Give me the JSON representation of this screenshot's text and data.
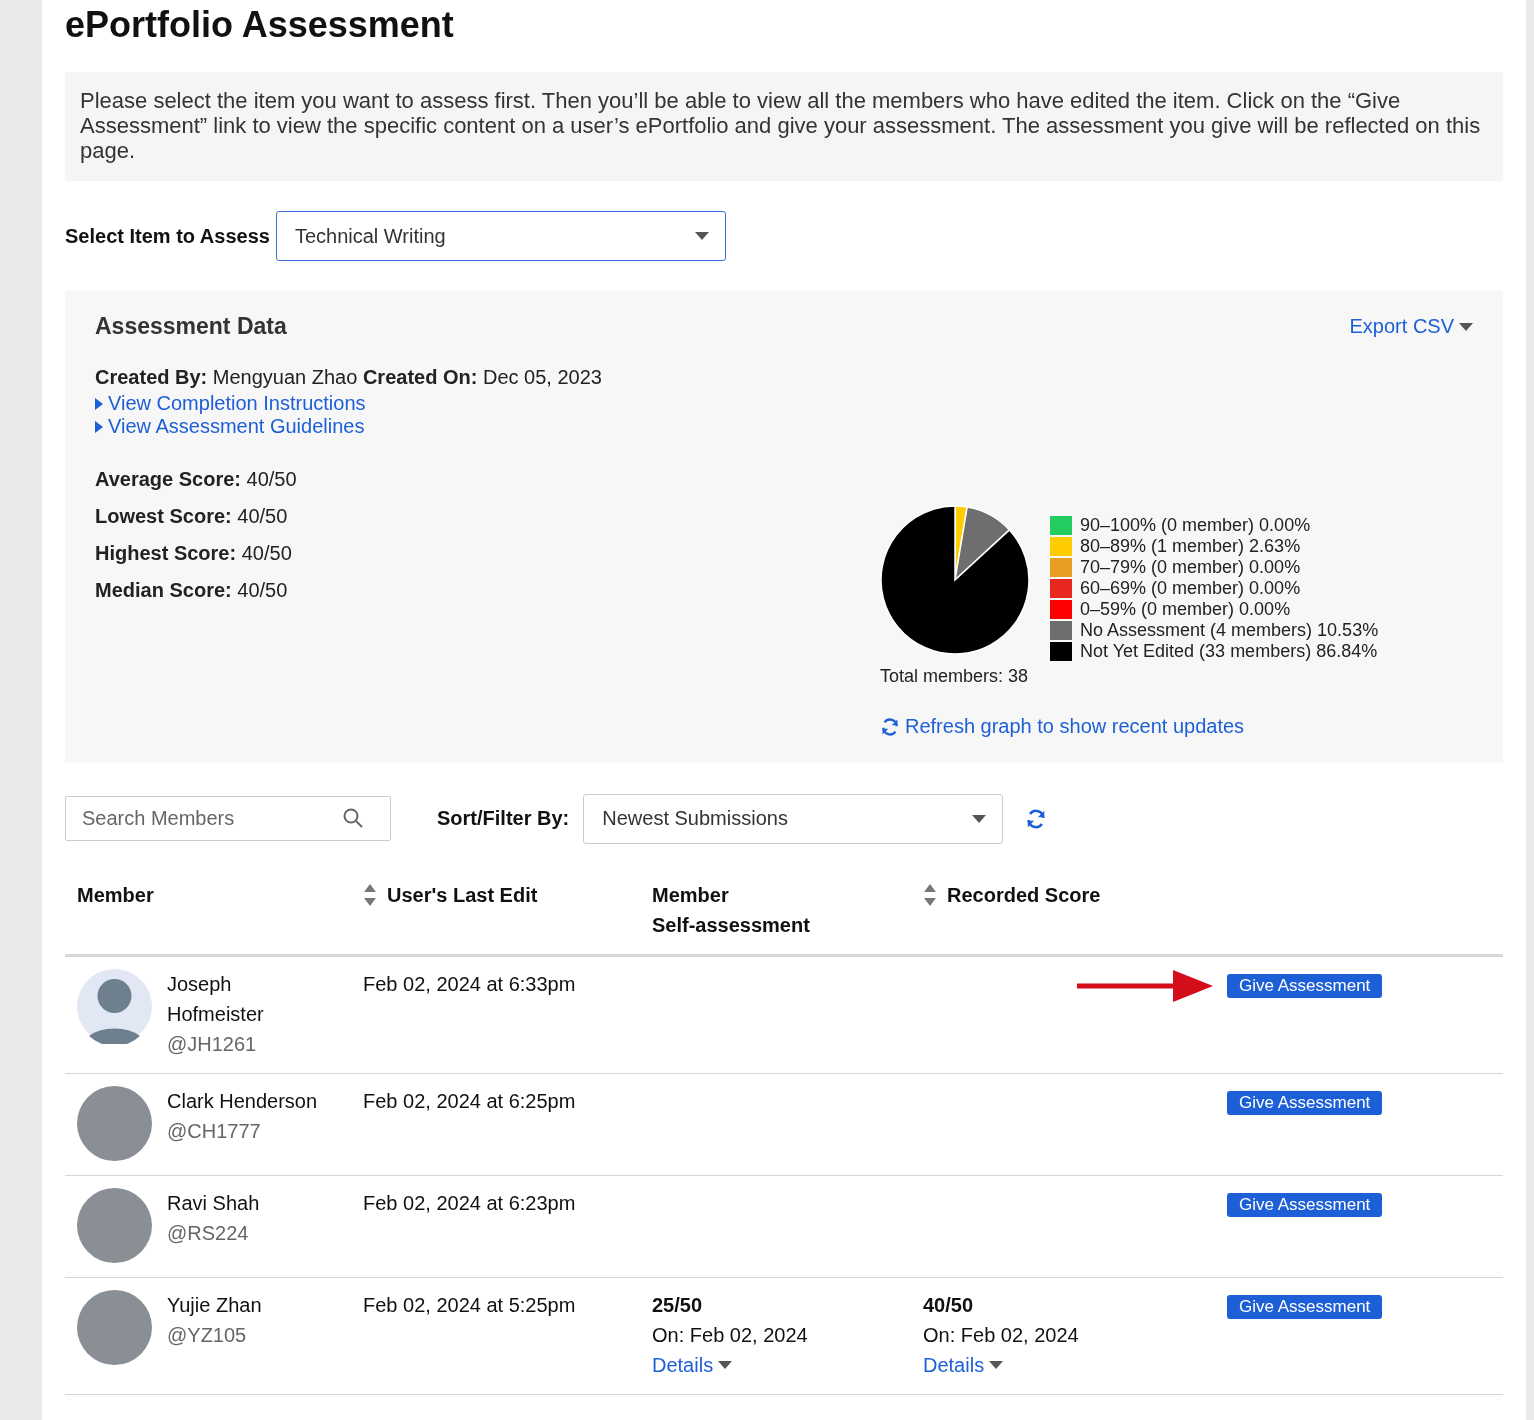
{
  "title": "ePortfolio Assessment",
  "intro": "Please select the item you want to assess first. Then you’ll be able to view all the members who have edited the item. Click on the “Give Assessment” link to view the specific content on a user’s ePortfolio and give your assessment. The assessment you give will be reflected on this page.",
  "item_select": {
    "label": "Select Item to Assess",
    "value": "Technical Writing"
  },
  "assessment_data": {
    "heading": "Assessment Data",
    "export_link": "Export CSV",
    "created": "**Created By:** Mengyuan Zhao **Created On:** Dec 05, 2023",
    "links": [
      "View Completion Instructions",
      "View Assessment Guidelines"
    ],
    "stats": [
      "**Average Score:** 40/50",
      "**Lowest Score:** 40/50",
      "**Highest Score:** 40/50",
      "**Median Score:** 40/50"
    ],
    "legend": [
      {
        "detail": "(0 member) 0.00%",
        "color": "#22cc5e"
      },
      {
        "detail": "(1 member) 2.63%",
        "color": "#ffcc00"
      },
      {
        "detail": "(0 member) 0.00%",
        "color": "#e89e22"
      },
      {
        "detail": "(0 member) 0.00%",
        "color": "#e8271f"
      },
      {
        "detail": "(0 member) 0.00%",
        "color": "#ff0000"
      },
      {
        "detail": "(4 members) 10.53%",
        "color": "#6e6e6e"
      },
      {
        "detail": "(33 members) 86.84%",
        "color": "#000000"
      }
    ],
    "chart_data": {
      "type": "pie",
      "categories": [
        "90–100%",
        "80–89%",
        "70–79%",
        "60–69%",
        "0–59%",
        "No Assessment",
        "Not Yet Edited"
      ],
      "series": [
        {
          "values": [
            0,
            2.63,
            0,
            0,
            0,
            10.53,
            86.84
          ]
        }
      ]
    },
    "total": "Total members: 38",
    "refresh_link": "Refresh graph to show recent updates"
  },
  "filters": {
    "search_placeholder": "Search Members",
    "sort_label": "Sort/Filter By:",
    "sort_value": "Newest Submissions"
  },
  "table": {
    "columns": [
      {
        "label": "Member",
        "sortable": false
      },
      {
        "label": "User's Last Edit",
        "sortable": true
      },
      {
        "label": "Member Self-assessment",
        "sortable": false
      },
      {
        "label": "Recorded Score",
        "sortable": true
      }
    ],
    "rows": [
      {
        "kind": "default",
        "name": "Joseph Hofmeister",
        "handle": "@JH1261",
        "last_edit": "Feb 02, 2024 at 6:33pm",
        "action": "Give Assessment",
        "arrow_marked": true
      },
      {
        "kind": "photo",
        "name": "Clark Henderson",
        "handle": "@CH1777",
        "last_edit": "Feb 02, 2024 at 6:25pm",
        "action": "Give Assessment",
        "arrow_marked": false
      },
      {
        "kind": "photo",
        "name": "Ravi Shah",
        "handle": "@RS224",
        "last_edit": "Feb 02, 2024 at 6:23pm",
        "action": "Give Assessment",
        "arrow_marked": false
      },
      {
        "kind": "photo",
        "name": "Yujie Zhan",
        "handle": "@YZ105",
        "last_edit": "Feb 02, 2024 at 5:25pm",
        "self_assessment": {
          "score": "25/50",
          "date": "On: Feb 02, 2024",
          "link": "Details"
        },
        "recorded": {
          "score": "40/50",
          "date": "On: Feb 02, 2024",
          "link": "Details"
        },
        "action": "Give Assessment",
        "arrow_marked": false
      }
    ]
  }
}
